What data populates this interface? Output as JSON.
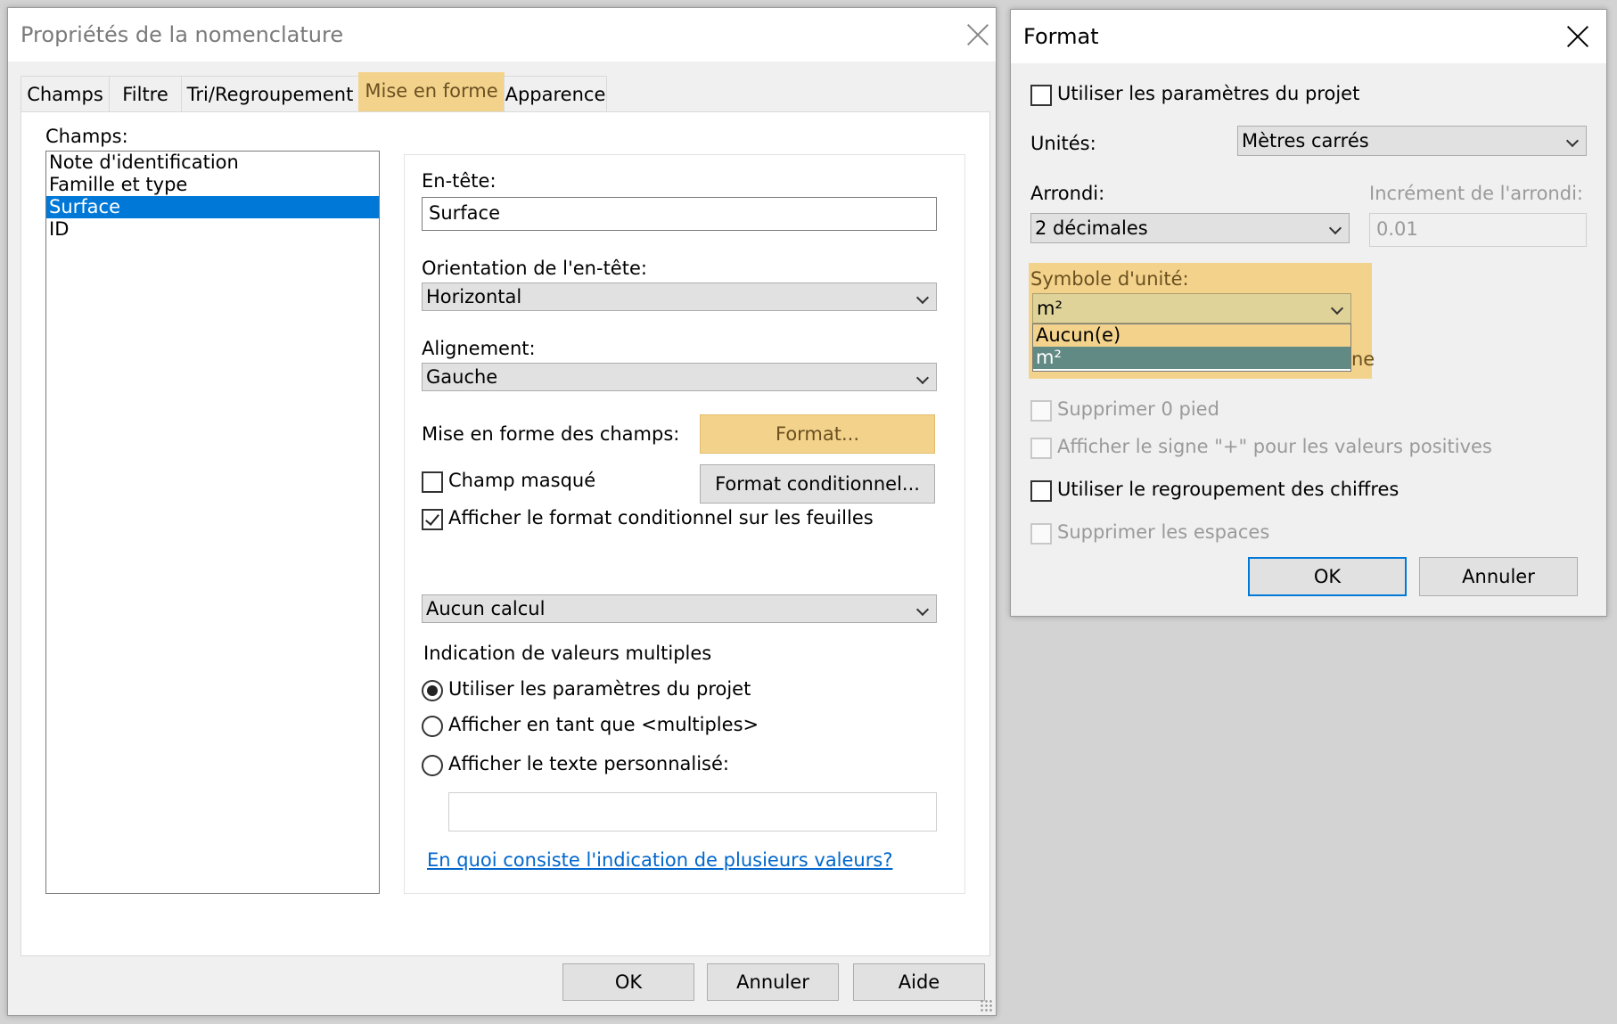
{
  "dialog_main": {
    "title": "Propriétés de la nomenclature",
    "tabs": [
      "Champs",
      "Filtre",
      "Tri/Regroupement",
      "Mise en forme",
      "Apparence"
    ],
    "active_tab": "Mise en forme",
    "fields_label": "Champs:",
    "fields": [
      "Note d'identification",
      "Famille et type",
      "Surface",
      "ID"
    ],
    "selected_field": "Surface",
    "heading_label": "En-tête:",
    "heading_value": "Surface",
    "heading_orientation_label": "Orientation de l'en-tête:",
    "heading_orientation_value": "Horizontal",
    "alignment_label": "Alignement:",
    "alignment_value": "Gauche",
    "field_formatting_label": "Mise en forme des champs:",
    "format_button": "Format...",
    "conditional_format_button": "Format conditionnel...",
    "hidden_field_label": "Champ masqué",
    "hidden_field_checked": false,
    "show_conditional_label": "Afficher le format conditionnel sur les feuilles",
    "show_conditional_checked": true,
    "calculation_value": "Aucun calcul",
    "multiple_values_heading": "Indication de valeurs multiples",
    "radio_options": [
      "Utiliser les paramètres du projet",
      "Afficher en tant que <multiples>",
      "Afficher le texte personnalisé:"
    ],
    "radio_selected_index": 0,
    "custom_text_value": "",
    "help_link": "En quoi consiste l'indication de plusieurs valeurs?",
    "ok_button": "OK",
    "cancel_button": "Annuler",
    "help_button": "Aide"
  },
  "dialog_format": {
    "title": "Format",
    "use_project_settings_label": "Utiliser les paramètres du projet",
    "use_project_settings_checked": false,
    "units_label": "Unités:",
    "units_value": "Mètres carrés",
    "rounding_label": "Arrondi:",
    "rounding_value": "2 décimales",
    "rounding_increment_label": "Incrément de l'arrondi:",
    "rounding_increment_value": "0.01",
    "unit_symbol_label": "Symbole d'unité:",
    "unit_symbol_value": "m²",
    "unit_symbol_options": [
      "Aucun(e)",
      "m²"
    ],
    "unit_symbol_hover": "Aucun(e)",
    "hidden_behind_suffix": "ne",
    "suppress_zero_feet_label": "Supprimer 0 pied",
    "show_plus_label": "Afficher le signe \"+\" pour les valeurs positives",
    "digit_grouping_label": "Utiliser le regroupement des chiffres",
    "digit_grouping_checked": false,
    "suppress_spaces_label": "Supprimer les espaces",
    "ok_button": "OK",
    "cancel_button": "Annuler"
  },
  "colors": {
    "highlight": "#f3d38c",
    "selection": "#0078d7",
    "dropdown_selected": "#628a84",
    "link": "#0066cc"
  }
}
